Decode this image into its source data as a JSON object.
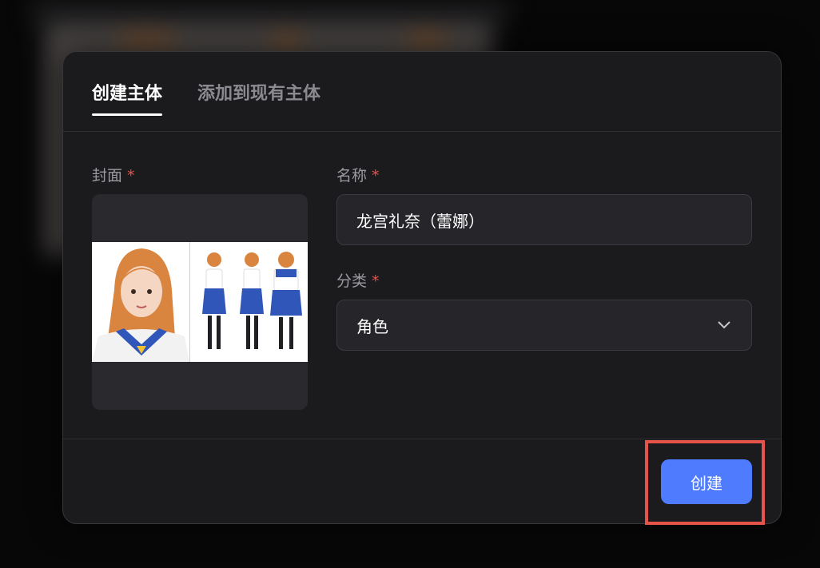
{
  "tabs": [
    {
      "label": "创建主体",
      "active": true
    },
    {
      "label": "添加到现有主体",
      "active": false
    }
  ],
  "form": {
    "cover_label": "封面",
    "name_label": "名称",
    "name_value": "龙宫礼奈（蕾娜）",
    "category_label": "分类",
    "category_value": "角色",
    "required_mark": "*"
  },
  "cover_image": "character-reference-sheet",
  "actions": {
    "create_label": "创建"
  },
  "colors": {
    "accent": "#4f7cff",
    "required": "#e5534b",
    "highlight": "#e5534b"
  }
}
